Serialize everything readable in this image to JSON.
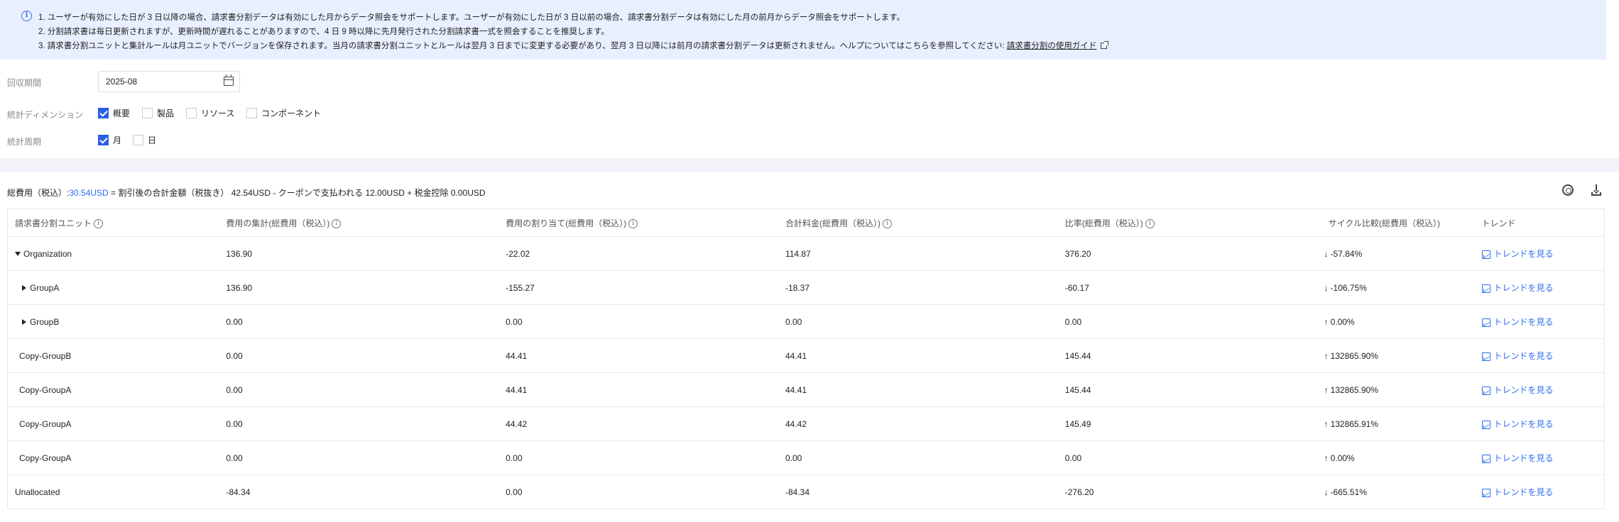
{
  "notice": {
    "line1": "1. ユーザーが有効にした日が 3 日以降の場合、請求書分割データは有効にした月からデータ照会をサポートします。ユーザーが有効にした日が 3 日以前の場合、請求書分割データは有効にした月の前月からデータ照会をサポートします。",
    "line2": "2. 分割請求書は毎日更新されますが、更新時間が遅れることがありますので、4 日 9 時以降に先月発行された分割請求書一式を照会することを推奨します。",
    "line3": "3. 請求書分割ユニットと集計ルールは月ユニットでバージョンを保存されます。当月の請求書分割ユニットとルールは翌月 3 日までに変更する必要があり、翌月 3 日以降には前月の請求書分割データは更新されません。ヘルプについてはこちらを参照してください: ",
    "link": "請求書分割の使用ガイド"
  },
  "filters": {
    "period_label": "回収期間",
    "period_value": "2025-08",
    "dimension_label": "統計ディメンション",
    "dimensions": [
      {
        "label": "概要",
        "checked": true
      },
      {
        "label": "製品",
        "checked": false
      },
      {
        "label": "リソース",
        "checked": false
      },
      {
        "label": "コンポーネント",
        "checked": false
      }
    ],
    "cycle_label": "統計周期",
    "cycles": [
      {
        "label": "月",
        "checked": true
      },
      {
        "label": "日",
        "checked": false
      }
    ]
  },
  "summary": {
    "prefix": "総費用（税込）:",
    "total": "30.54USD",
    "rest": " = 割引後の合計金額（税抜き） 42.54USD - クーポンで支払われる 12.00USD + 税金控除 0.00USD"
  },
  "table": {
    "headers": [
      "請求書分割ユニット",
      "費用の集計(総費用（税込）)",
      "費用の割り当て(総費用（税込）)",
      "合計料金(総費用（税込）)",
      "比率(総費用（税込）)",
      "サイクル比較(総費用（税込）)",
      "トレンド"
    ],
    "trend_label": "トレンドを見る",
    "rows": [
      {
        "name": "Organization",
        "c2": "136.90",
        "c3": "-22.02",
        "c4": "114.87",
        "c5": "376.20",
        "pct": "-57.84%"
      },
      {
        "name": "GroupA",
        "c2": "136.90",
        "c3": "-155.27",
        "c4": "-18.37",
        "c5": "-60.17",
        "pct": "-106.75%"
      },
      {
        "name": "GroupB",
        "c2": "0.00",
        "c3": "0.00",
        "c4": "0.00",
        "c5": "0.00",
        "pct": "0.00%"
      },
      {
        "name": "Copy-GroupB",
        "c2": "0.00",
        "c3": "44.41",
        "c4": "44.41",
        "c5": "145.44",
        "pct": "132865.90%"
      },
      {
        "name": "Copy-GroupA",
        "c2": "0.00",
        "c3": "44.41",
        "c4": "44.41",
        "c5": "145.44",
        "pct": "132865.90%"
      },
      {
        "name": "Copy-GroupA",
        "c2": "0.00",
        "c3": "44.42",
        "c4": "44.42",
        "c5": "145.49",
        "pct": "132865.91%"
      },
      {
        "name": "Copy-GroupA",
        "c2": "0.00",
        "c3": "0.00",
        "c4": "0.00",
        "c5": "0.00",
        "pct": "0.00%"
      },
      {
        "name": "Unallocated",
        "c2": "-84.34",
        "c3": "0.00",
        "c4": "-84.34",
        "c5": "-276.20",
        "pct": "-665.51%"
      }
    ]
  },
  "colors": {
    "accent": "#2b5ee8",
    "up": "#e33b3b",
    "down": "#1aa34a",
    "notice_bg": "#e8efff"
  },
  "icons": [
    "info-icon",
    "calendar-icon",
    "external-link-icon",
    "gear-icon",
    "download-icon",
    "info-circle-icon",
    "trend-chart-icon",
    "arrow-up-icon",
    "arrow-down-icon"
  ]
}
